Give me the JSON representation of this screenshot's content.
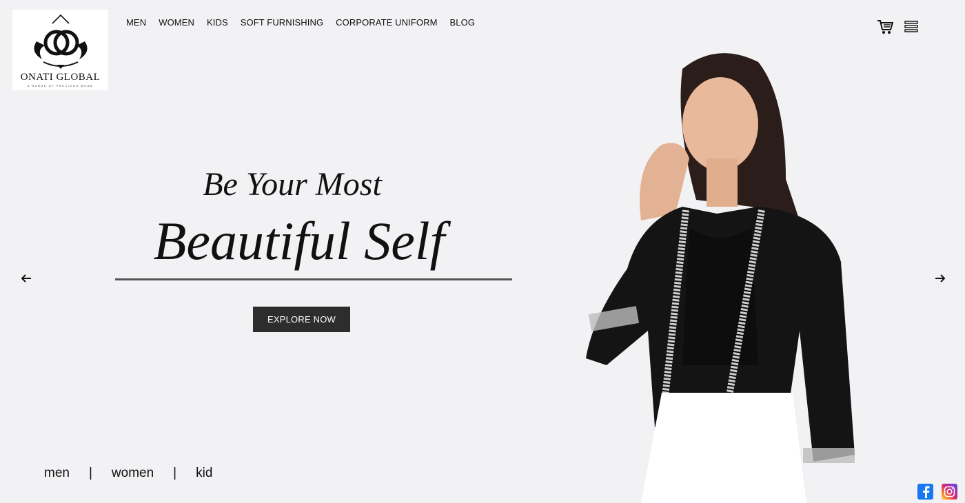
{
  "brand": {
    "name": "ONATI GLOBAL",
    "tagline": "A RANGE OF PRECIOUS WEAR"
  },
  "nav": {
    "items": [
      "MEN",
      "WOMEN",
      "KIDS",
      "SOFT FURNISHING",
      "CORPORATE UNIFORM",
      "BLOG"
    ]
  },
  "header_icons": [
    "cart-icon",
    "menu-icon"
  ],
  "hero": {
    "line1": "Be Your Most",
    "line2": "Beautiful Self",
    "cta_label": "EXPLORE NOW"
  },
  "carousel": {
    "prev_icon": "arrow-left-icon",
    "next_icon": "arrow-right-icon"
  },
  "bottom_links": {
    "items": [
      "men",
      "women",
      "kid"
    ],
    "separator": "|"
  },
  "social": [
    "facebook-icon",
    "instagram-icon"
  ],
  "colors": {
    "background": "#f2f1f3",
    "button_bg": "#2d2d2d",
    "facebook": "#1877f2"
  }
}
